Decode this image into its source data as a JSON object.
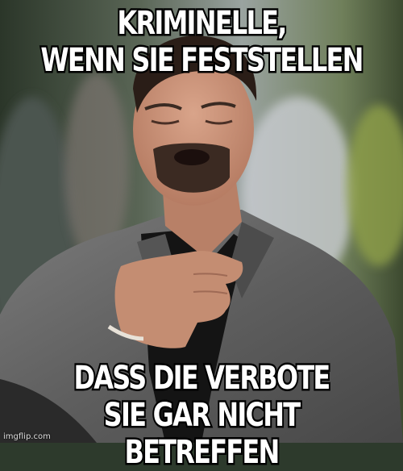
{
  "meme": {
    "top_text": [
      "KRIMINELLE,",
      "WENN SIE FESTSTELLEN"
    ],
    "bottom_text": [
      "DASS DIE VERBOTE",
      "SIE GAR NICHT BETREFFEN"
    ],
    "watermark": "imgflip.com"
  },
  "colors": {
    "caption_fill": "#ffffff",
    "caption_outline": "#000000",
    "suit": "#6a6a6a",
    "shirt": "#141414",
    "background_blur": "#2f3f2c"
  }
}
